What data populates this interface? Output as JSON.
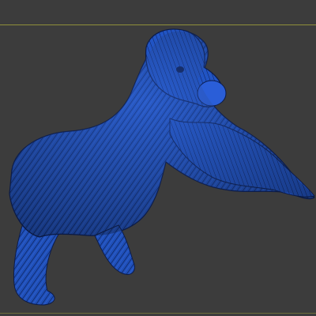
{
  "viewport": {
    "background": "#3c3c3c",
    "frame_color": "#8f8f3a"
  },
  "model": {
    "subject": "gorilla-icon",
    "color": "#1f4fb8",
    "fur_shadow": "#0b1b4a",
    "highlight": "#3a6ee0"
  }
}
